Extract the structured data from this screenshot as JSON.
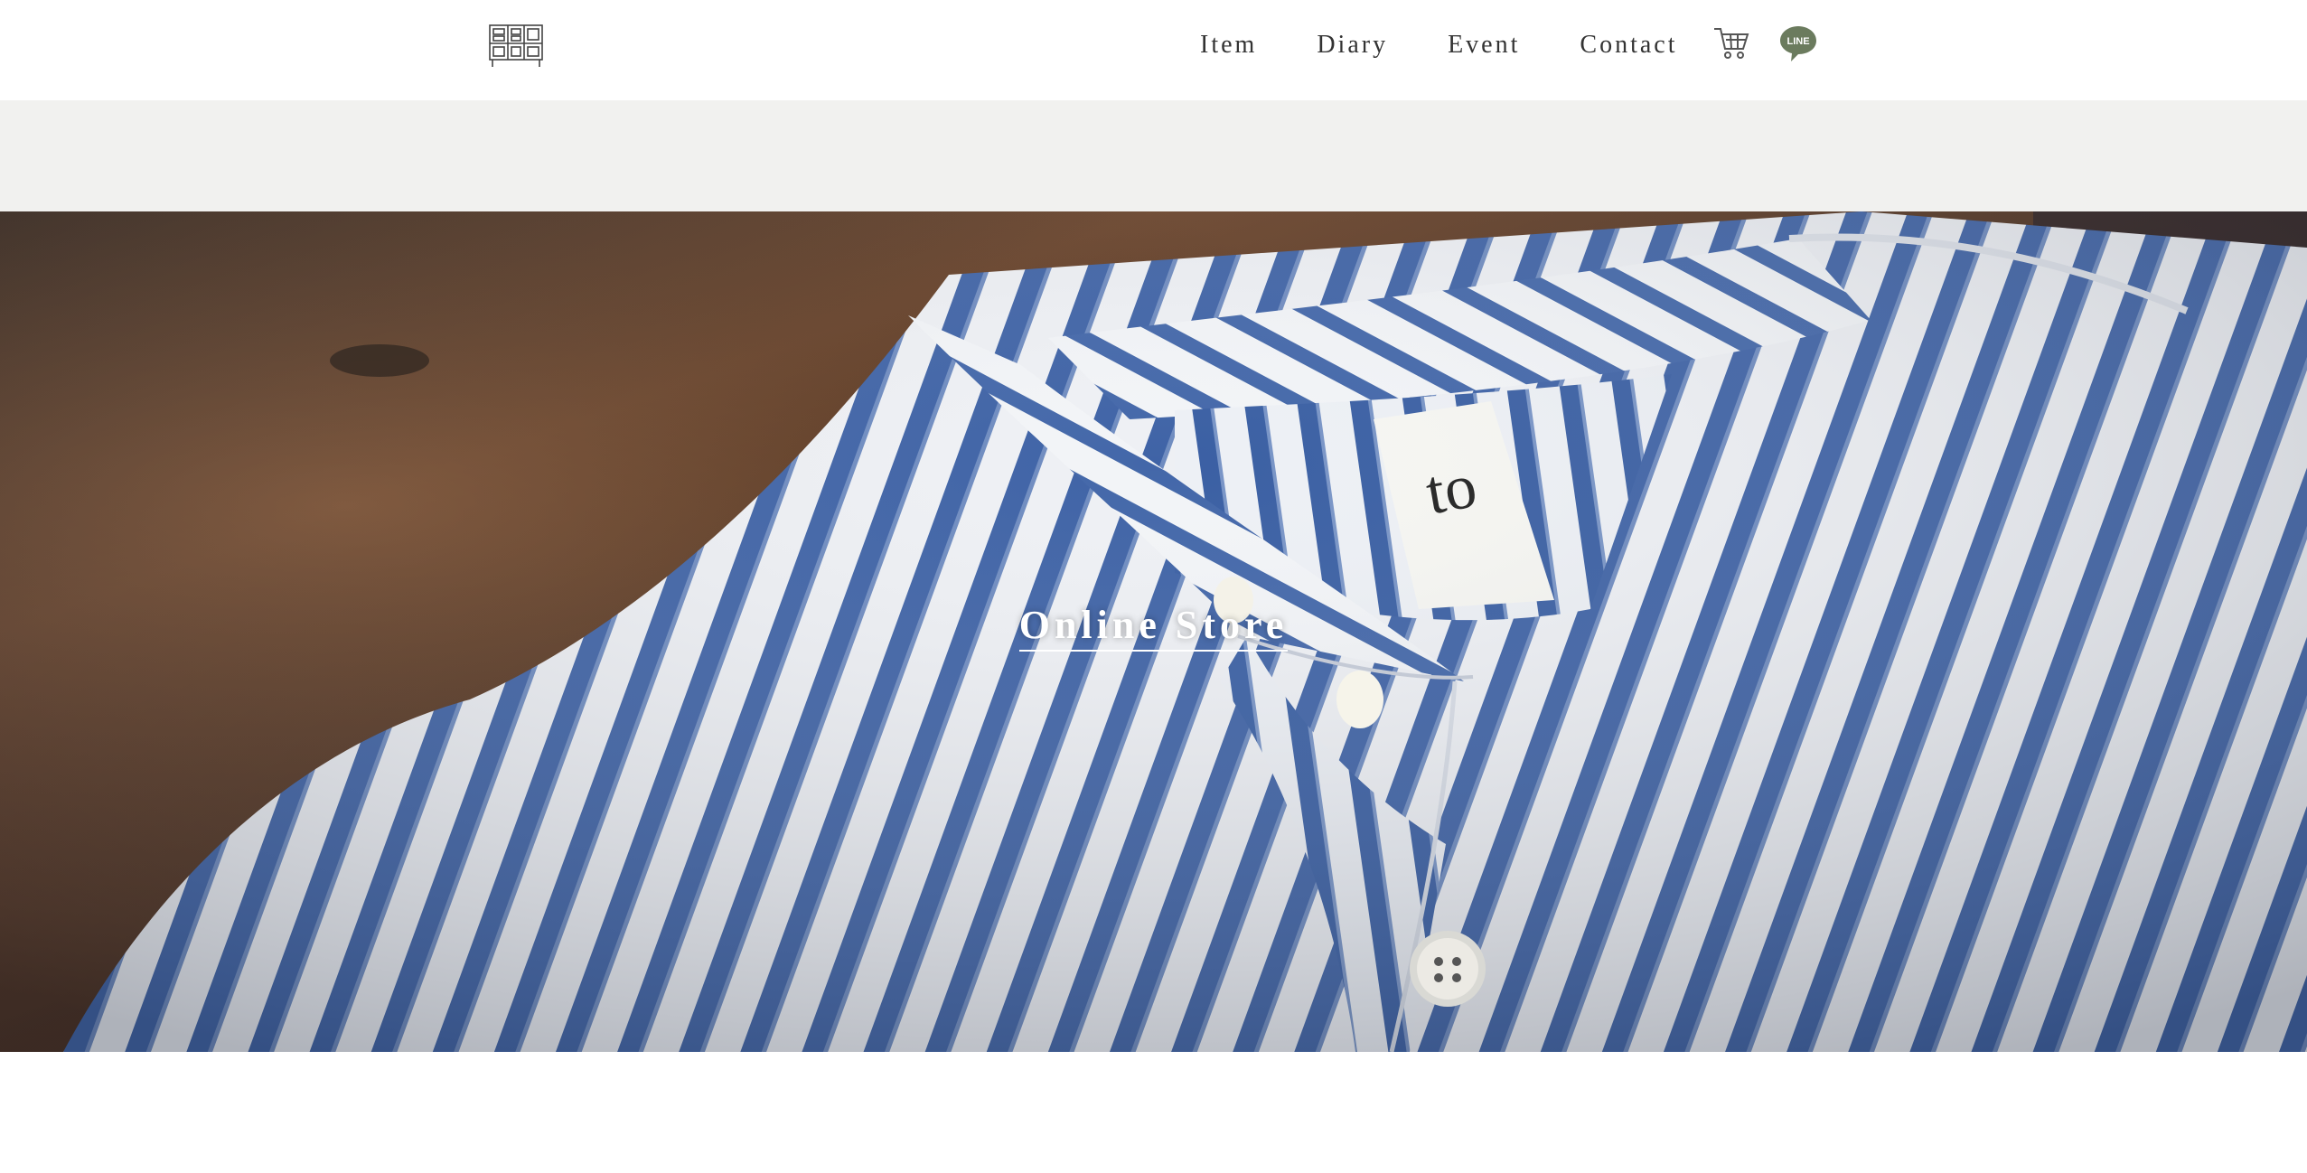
{
  "header": {
    "logo_icon": "drawer-cabinet-icon",
    "nav": [
      {
        "label": "Item"
      },
      {
        "label": "Diary"
      },
      {
        "label": "Event"
      },
      {
        "label": "Contact"
      }
    ],
    "cart_icon": "shopping-cart-icon",
    "line_badge": {
      "label": "LINE",
      "icon": "line-chat-icon",
      "color": "#6b7b5e"
    }
  },
  "hero": {
    "title": "Online Store",
    "image": "striped-shirt-collar-photo",
    "colors": {
      "wood": "#5a3a24",
      "stripe_blue": "#3f63a6",
      "fabric_white": "#eef0f4"
    }
  }
}
